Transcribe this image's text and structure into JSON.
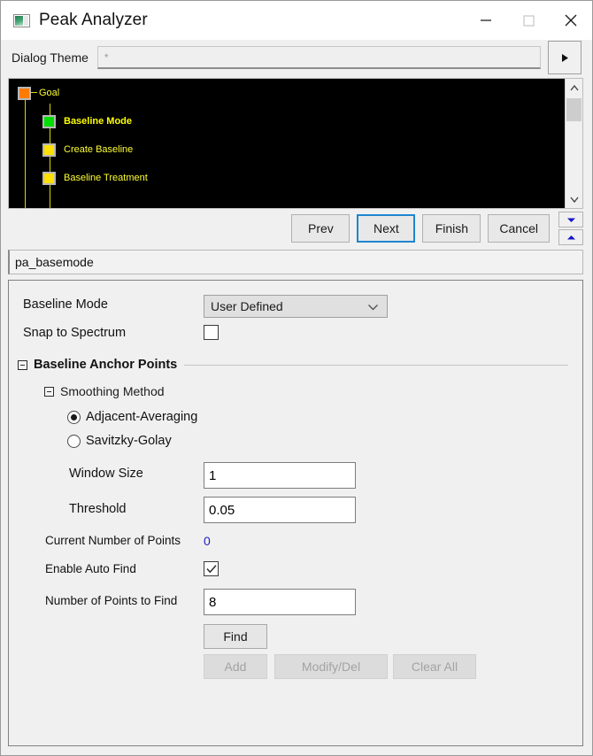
{
  "window": {
    "title": "Peak Analyzer",
    "icon": "app-icon",
    "controls": {
      "minimize": "minimize-icon",
      "maximize": "maximize-icon",
      "close": "close-icon"
    }
  },
  "theme": {
    "label": "Dialog Theme",
    "value": "*",
    "placeholder": "*",
    "expand_button": "arrow-right-icon"
  },
  "tree": {
    "nodes": [
      {
        "label": "Goal",
        "color": "#ff7b00",
        "selected": false,
        "indent": 0
      },
      {
        "label": "Baseline Mode",
        "color": "#00dd00",
        "selected": true,
        "indent": 1
      },
      {
        "label": "Create Baseline",
        "color": "#ffe000",
        "selected": false,
        "indent": 1
      },
      {
        "label": "Baseline Treatment",
        "color": "#ffe000",
        "selected": false,
        "indent": 1
      }
    ],
    "scroll_up": "chevron-up-icon",
    "scroll_down": "chevron-down-icon"
  },
  "nav": {
    "prev": "Prev",
    "next": "Next",
    "finish": "Finish",
    "cancel": "Cancel",
    "focused_button": "Next",
    "spin_down": "triangle-down-icon",
    "spin_up": "triangle-up-icon"
  },
  "name_field": {
    "value": "pa_basemode"
  },
  "form": {
    "baseline_mode": {
      "label": "Baseline Mode",
      "value": "User Defined",
      "options": [
        "User Defined"
      ]
    },
    "snap_to_spectrum": {
      "label": "Snap to Spectrum",
      "checked": false
    },
    "anchor_points_group": {
      "title": "Baseline Anchor Points",
      "expanded": true
    },
    "smoothing_group": {
      "title": "Smoothing Method",
      "expanded": true
    },
    "smoothing_options": [
      {
        "label": "Adjacent-Averaging",
        "selected": true
      },
      {
        "label": "Savitzky-Golay",
        "selected": false
      }
    ],
    "window_size": {
      "label": "Window Size",
      "value": "1"
    },
    "threshold": {
      "label": "Threshold",
      "value": "0.05"
    },
    "current_points": {
      "label": "Current Number of Points",
      "value": "0",
      "color": "#2222bb"
    },
    "enable_auto_find": {
      "label": "Enable Auto Find",
      "checked": true
    },
    "points_to_find": {
      "label": "Number of Points to Find",
      "value": "8"
    },
    "find_button": "Find",
    "add_button": "Add",
    "modify_del_button": "Modify/Del",
    "clear_all_button": "Clear All"
  },
  "colors": {
    "accent_focus": "#1e85d0",
    "tree_bg": "#000000",
    "tree_text": "#ffff33",
    "value_blue": "#2222bb"
  }
}
